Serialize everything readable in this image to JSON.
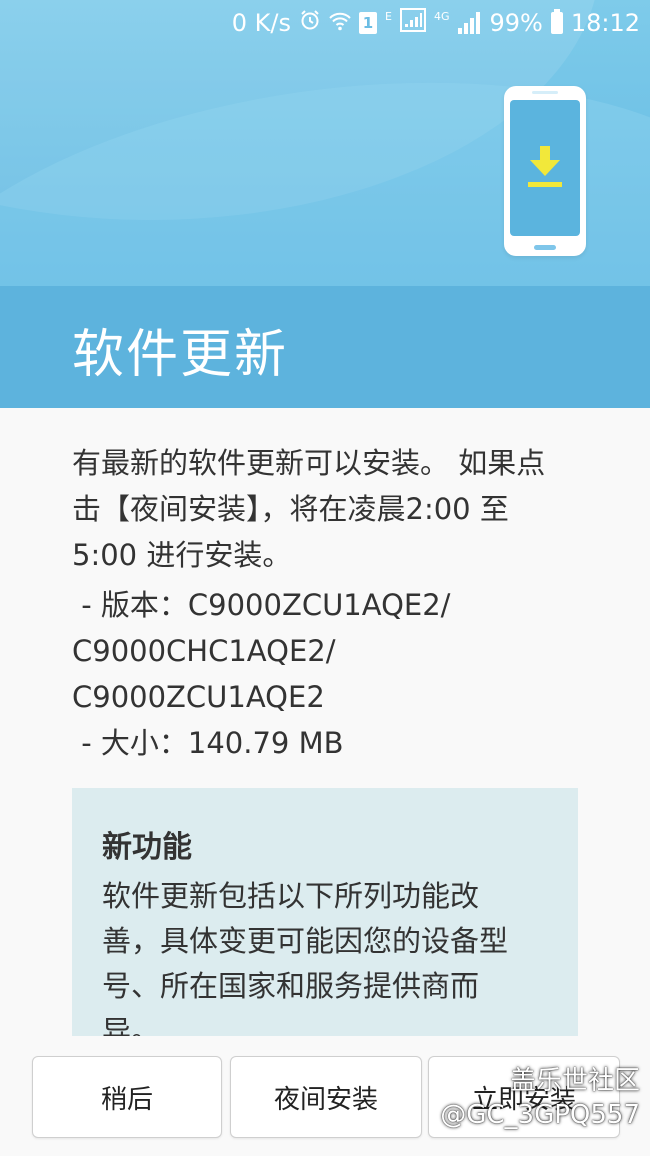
{
  "status_bar": {
    "net_speed": "0 K/s",
    "sim_slot": "1",
    "network_e": "E",
    "network_4g": "4G",
    "battery": "99%",
    "time": "18:12"
  },
  "header": {
    "title": "软件更新"
  },
  "body": {
    "intro": "有最新的软件更新可以安装。 如果点击【夜间安装】，将在凌晨2:00 至 5:00 进行安装。",
    "version_label": " - 版本：",
    "version_line1": "C9000ZCU1AQE2/",
    "version_line2": "C9000CHC1AQE2/",
    "version_line3": "C9000ZCU1AQE2",
    "size_line": " - 大小：140.79 MB"
  },
  "features": {
    "heading": "新功能",
    "text": "软件更新包括以下所列功能改善，具体变更可能因您的设备型号、所在国家和服务提供商而异。"
  },
  "buttons": {
    "later": "稍后",
    "night_install": "夜间安装",
    "install_now": "立即安装"
  },
  "watermark": {
    "line1": "盖乐世社区",
    "line2": "@GC_3GPQ557"
  },
  "colors": {
    "header_blue": "#5db3dd",
    "hero_blue": "#7ecbea",
    "feature_bg": "#dcecef",
    "download_arrow": "#f2e83a"
  }
}
